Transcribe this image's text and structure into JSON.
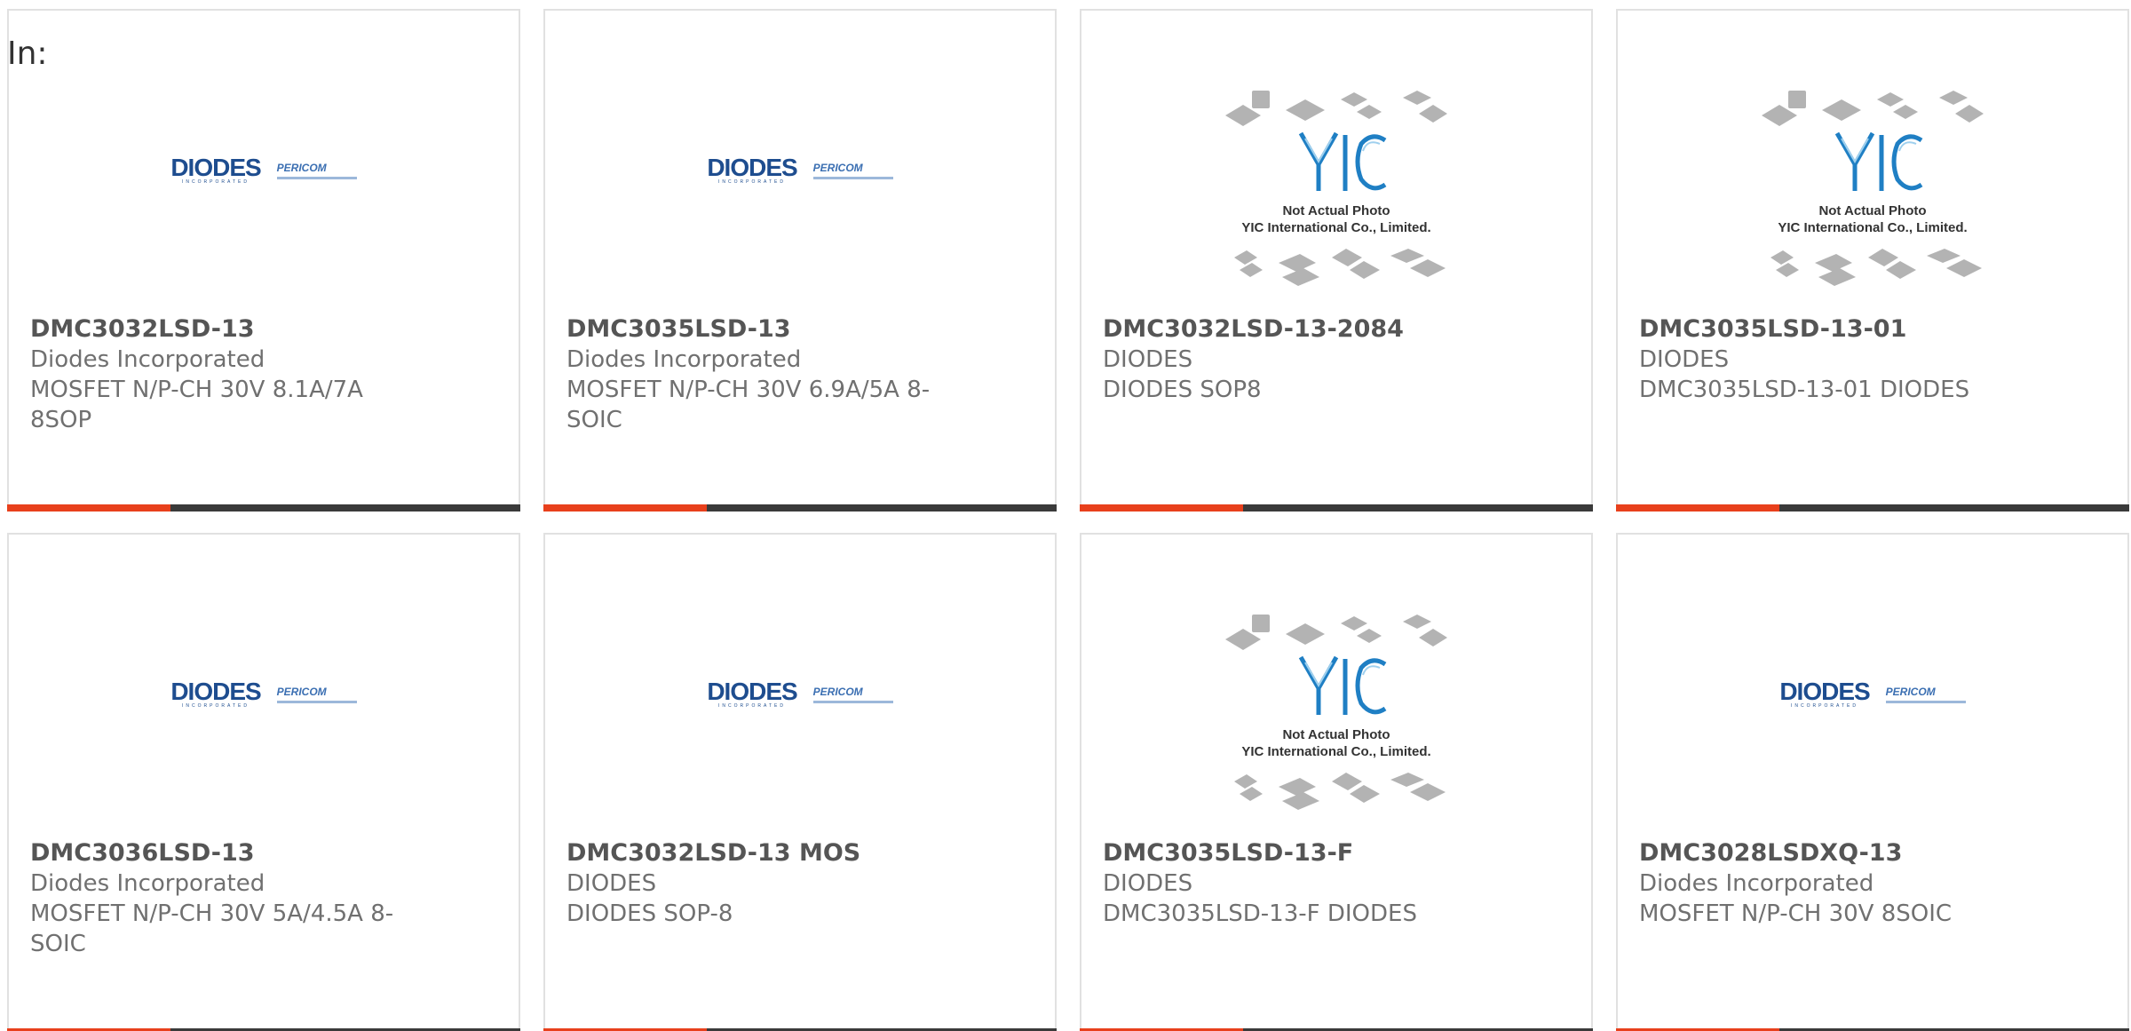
{
  "header": {
    "label": "In:"
  },
  "cards": [
    {
      "part_number": "DMC3032LSD-13",
      "manufacturer": "Diodes Incorporated",
      "description": "MOSFET N/P-CH 30V 8.1A/7A 8SOP",
      "image": "diodes-pericom-logo"
    },
    {
      "part_number": "DMC3035LSD-13",
      "manufacturer": "Diodes Incorporated",
      "description": "MOSFET N/P-CH 30V 6.9A/5A 8-SOIC",
      "image": "diodes-pericom-logo"
    },
    {
      "part_number": "DMC3032LSD-13-2084",
      "manufacturer": "DIODES",
      "description": "DIODES SOP8",
      "image": "yic-placeholder"
    },
    {
      "part_number": "DMC3035LSD-13-01",
      "manufacturer": "DIODES",
      "description": "DMC3035LSD-13-01 DIODES",
      "image": "yic-placeholder"
    },
    {
      "part_number": "DMC3036LSD-13",
      "manufacturer": "Diodes Incorporated",
      "description": "MOSFET N/P-CH 30V 5A/4.5A 8-SOIC",
      "image": "diodes-pericom-logo"
    },
    {
      "part_number": "DMC3032LSD-13 MOS",
      "manufacturer": "DIODES",
      "description": "DIODES SOP-8",
      "image": "diodes-pericom-logo"
    },
    {
      "part_number": "DMC3035LSD-13-F",
      "manufacturer": "DIODES",
      "description": "DMC3035LSD-13-F DIODES",
      "image": "yic-placeholder"
    },
    {
      "part_number": "DMC3028LSDXQ-13",
      "manufacturer": "Diodes Incorporated",
      "description": "MOSFET N/P-CH 30V 8SOIC",
      "image": "diodes-pericom-logo"
    }
  ],
  "logos": {
    "diodes_word": "DIODES",
    "diodes_sub": "INCORPORATED",
    "pericom_word": "PERICOM",
    "yic_line1": "Not Actual Photo",
    "yic_line2": "YIC International Co., Limited."
  },
  "colors": {
    "accent": "#e8401c",
    "bar": "#3a3a3a",
    "border": "#e1e1e1",
    "diodes_blue": "#1e4d8f",
    "yic_blue": "#1f7fc4"
  }
}
